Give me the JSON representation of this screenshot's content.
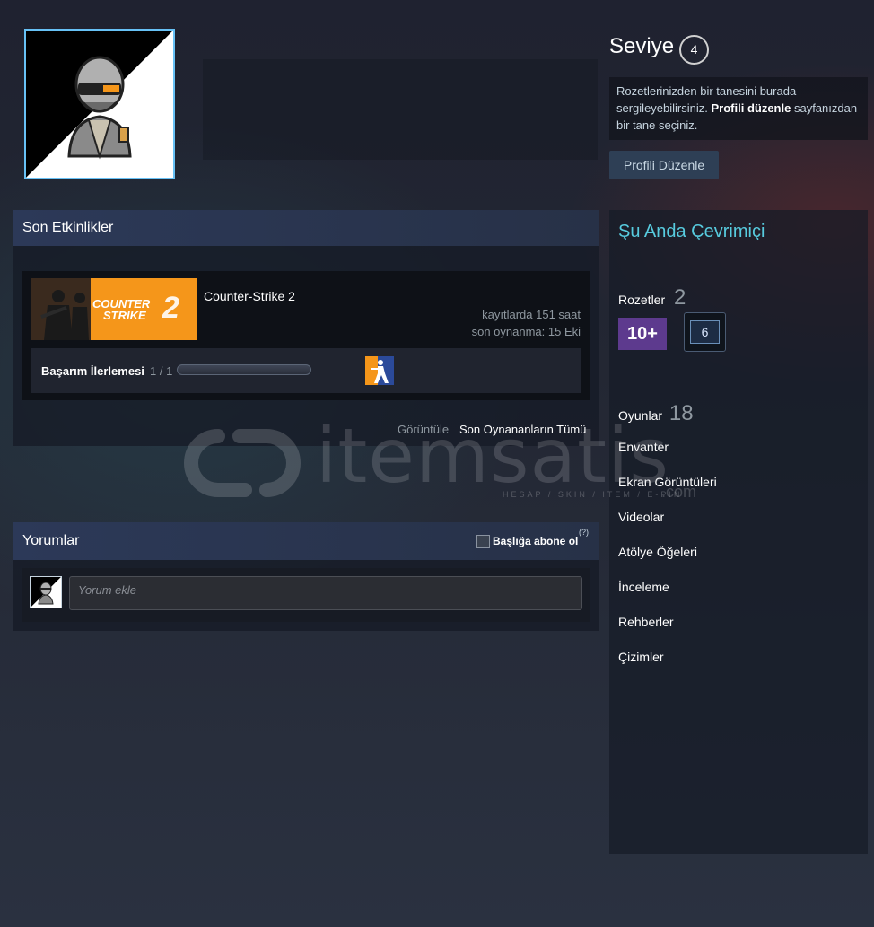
{
  "header": {
    "level_label": "Seviye",
    "level_value": "4",
    "badge_hint_prefix": "Rozetlerinizden bir tanesini burada sergileyebilirsiniz.",
    "badge_hint_link": "Profili düzenle",
    "badge_hint_suffix": "sayfanızdan bir tane seçiniz.",
    "edit_profile_button": "Profili Düzenle"
  },
  "activity": {
    "title": "Son Etkinlikler",
    "game": {
      "capsule_text_line1": "COUNTER",
      "capsule_text_line2": "STRIKE",
      "capsule_number": "2",
      "name": "Counter-Strike 2",
      "hours": "kayıtlarda 151 saat",
      "last_played": "son oynanma: 15 Eki",
      "achievement_label": "Başarım İlerlemesi",
      "achievement_count": "1 / 1",
      "achievement_progress": 1.0
    },
    "view_prefix": "Görüntüle",
    "view_link": "Son Oynananların Tümü"
  },
  "comments": {
    "title": "Yorumlar",
    "subscribe_label": "Başlığa abone ol",
    "help": "(?)",
    "input_placeholder": "Yorum ekle"
  },
  "sidebar": {
    "status": "Şu Anda Çevrimiçi",
    "badges_label": "Rozetler",
    "badges_count": "2",
    "badge_1_text": "10+",
    "badge_2_text": "6",
    "games_label": "Oyunlar",
    "games_count": "18",
    "links": [
      "Envanter",
      "Ekran Görüntüleri",
      "Videolar",
      "Atölye Öğeleri",
      "İnceleme",
      "Rehberler",
      "Çizimler"
    ]
  },
  "watermark": {
    "text": "itemsatis",
    "sub": "HESAP / SKIN / ITEM / E-PIN",
    "com": ".com"
  },
  "colors": {
    "accent_online": "#57cbde",
    "avatar_border": "#67c1f5",
    "capsule_orange": "#f5961a"
  }
}
